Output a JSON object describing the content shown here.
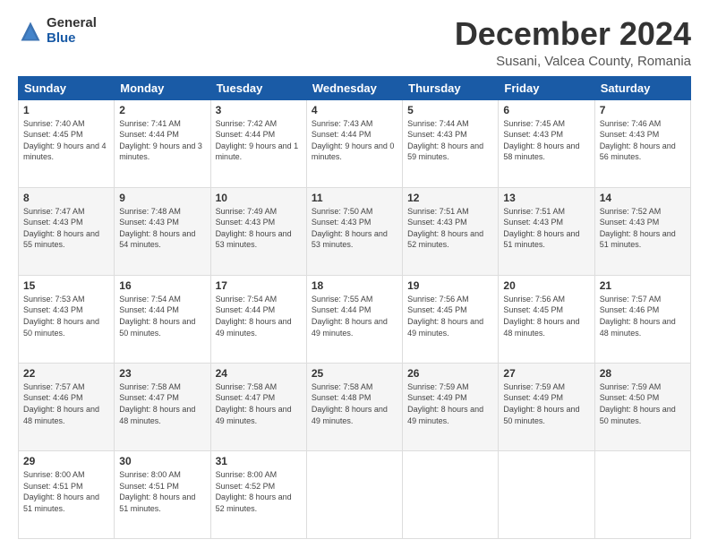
{
  "header": {
    "logo_general": "General",
    "logo_blue": "Blue",
    "title": "December 2024",
    "subtitle": "Susani, Valcea County, Romania"
  },
  "days_of_week": [
    "Sunday",
    "Monday",
    "Tuesday",
    "Wednesday",
    "Thursday",
    "Friday",
    "Saturday"
  ],
  "weeks": [
    [
      {
        "day": "1",
        "sunrise": "7:40 AM",
        "sunset": "4:45 PM",
        "daylight": "9 hours and 4 minutes."
      },
      {
        "day": "2",
        "sunrise": "7:41 AM",
        "sunset": "4:44 PM",
        "daylight": "9 hours and 3 minutes."
      },
      {
        "day": "3",
        "sunrise": "7:42 AM",
        "sunset": "4:44 PM",
        "daylight": "9 hours and 1 minute."
      },
      {
        "day": "4",
        "sunrise": "7:43 AM",
        "sunset": "4:44 PM",
        "daylight": "9 hours and 0 minutes."
      },
      {
        "day": "5",
        "sunrise": "7:44 AM",
        "sunset": "4:43 PM",
        "daylight": "8 hours and 59 minutes."
      },
      {
        "day": "6",
        "sunrise": "7:45 AM",
        "sunset": "4:43 PM",
        "daylight": "8 hours and 58 minutes."
      },
      {
        "day": "7",
        "sunrise": "7:46 AM",
        "sunset": "4:43 PM",
        "daylight": "8 hours and 56 minutes."
      }
    ],
    [
      {
        "day": "8",
        "sunrise": "7:47 AM",
        "sunset": "4:43 PM",
        "daylight": "8 hours and 55 minutes."
      },
      {
        "day": "9",
        "sunrise": "7:48 AM",
        "sunset": "4:43 PM",
        "daylight": "8 hours and 54 minutes."
      },
      {
        "day": "10",
        "sunrise": "7:49 AM",
        "sunset": "4:43 PM",
        "daylight": "8 hours and 53 minutes."
      },
      {
        "day": "11",
        "sunrise": "7:50 AM",
        "sunset": "4:43 PM",
        "daylight": "8 hours and 53 minutes."
      },
      {
        "day": "12",
        "sunrise": "7:51 AM",
        "sunset": "4:43 PM",
        "daylight": "8 hours and 52 minutes."
      },
      {
        "day": "13",
        "sunrise": "7:51 AM",
        "sunset": "4:43 PM",
        "daylight": "8 hours and 51 minutes."
      },
      {
        "day": "14",
        "sunrise": "7:52 AM",
        "sunset": "4:43 PM",
        "daylight": "8 hours and 51 minutes."
      }
    ],
    [
      {
        "day": "15",
        "sunrise": "7:53 AM",
        "sunset": "4:43 PM",
        "daylight": "8 hours and 50 minutes."
      },
      {
        "day": "16",
        "sunrise": "7:54 AM",
        "sunset": "4:44 PM",
        "daylight": "8 hours and 50 minutes."
      },
      {
        "day": "17",
        "sunrise": "7:54 AM",
        "sunset": "4:44 PM",
        "daylight": "8 hours and 49 minutes."
      },
      {
        "day": "18",
        "sunrise": "7:55 AM",
        "sunset": "4:44 PM",
        "daylight": "8 hours and 49 minutes."
      },
      {
        "day": "19",
        "sunrise": "7:56 AM",
        "sunset": "4:45 PM",
        "daylight": "8 hours and 49 minutes."
      },
      {
        "day": "20",
        "sunrise": "7:56 AM",
        "sunset": "4:45 PM",
        "daylight": "8 hours and 48 minutes."
      },
      {
        "day": "21",
        "sunrise": "7:57 AM",
        "sunset": "4:46 PM",
        "daylight": "8 hours and 48 minutes."
      }
    ],
    [
      {
        "day": "22",
        "sunrise": "7:57 AM",
        "sunset": "4:46 PM",
        "daylight": "8 hours and 48 minutes."
      },
      {
        "day": "23",
        "sunrise": "7:58 AM",
        "sunset": "4:47 PM",
        "daylight": "8 hours and 48 minutes."
      },
      {
        "day": "24",
        "sunrise": "7:58 AM",
        "sunset": "4:47 PM",
        "daylight": "8 hours and 49 minutes."
      },
      {
        "day": "25",
        "sunrise": "7:58 AM",
        "sunset": "4:48 PM",
        "daylight": "8 hours and 49 minutes."
      },
      {
        "day": "26",
        "sunrise": "7:59 AM",
        "sunset": "4:49 PM",
        "daylight": "8 hours and 49 minutes."
      },
      {
        "day": "27",
        "sunrise": "7:59 AM",
        "sunset": "4:49 PM",
        "daylight": "8 hours and 50 minutes."
      },
      {
        "day": "28",
        "sunrise": "7:59 AM",
        "sunset": "4:50 PM",
        "daylight": "8 hours and 50 minutes."
      }
    ],
    [
      {
        "day": "29",
        "sunrise": "8:00 AM",
        "sunset": "4:51 PM",
        "daylight": "8 hours and 51 minutes."
      },
      {
        "day": "30",
        "sunrise": "8:00 AM",
        "sunset": "4:51 PM",
        "daylight": "8 hours and 51 minutes."
      },
      {
        "day": "31",
        "sunrise": "8:00 AM",
        "sunset": "4:52 PM",
        "daylight": "8 hours and 52 minutes."
      },
      null,
      null,
      null,
      null
    ]
  ],
  "labels": {
    "sunrise": "Sunrise:",
    "sunset": "Sunset:",
    "daylight": "Daylight:"
  }
}
